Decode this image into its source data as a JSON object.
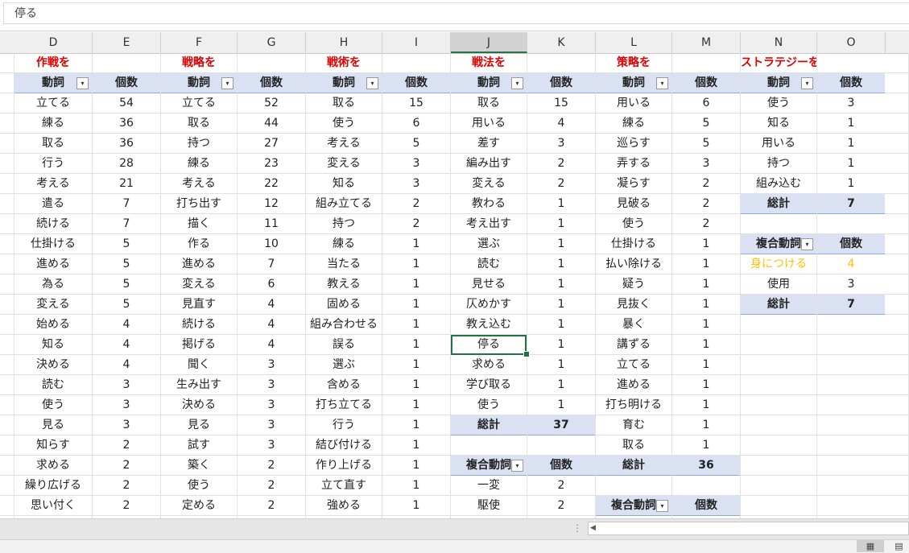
{
  "formula_bar": {
    "value": "停る"
  },
  "columns": [
    "D",
    "E",
    "F",
    "G",
    "H",
    "I",
    "J",
    "K",
    "L",
    "M",
    "N",
    "O"
  ],
  "selected_column": "J",
  "selected_cell": {
    "column": "J",
    "row": 14,
    "value": "停る"
  },
  "colors": {
    "header_fill": "#d9e1f2",
    "title_red": "#e00000",
    "selection_green": "#217346",
    "highlight_yellow": "#ffc000"
  },
  "tables": [
    {
      "title": "作戦を",
      "header": {
        "verb": "動詞",
        "count": "個数"
      },
      "rows": [
        [
          "立てる",
          "54"
        ],
        [
          "練る",
          "36"
        ],
        [
          "取る",
          "36"
        ],
        [
          "行う",
          "28"
        ],
        [
          "考える",
          "21"
        ],
        [
          "遣る",
          "7"
        ],
        [
          "続ける",
          "7"
        ],
        [
          "仕掛ける",
          "5"
        ],
        [
          "進める",
          "5"
        ],
        [
          "為る",
          "5"
        ],
        [
          "変える",
          "5"
        ],
        [
          "始める",
          "4"
        ],
        [
          "知る",
          "4"
        ],
        [
          "決める",
          "4"
        ],
        [
          "読む",
          "3"
        ],
        [
          "使う",
          "3"
        ],
        [
          "見る",
          "3"
        ],
        [
          "知らす",
          "2"
        ],
        [
          "求める",
          "2"
        ],
        [
          "繰り広げる",
          "2"
        ],
        [
          "思い付く",
          "2"
        ]
      ]
    },
    {
      "title": "戦略を",
      "header": {
        "verb": "動詞",
        "count": "個数"
      },
      "rows": [
        [
          "立てる",
          "52"
        ],
        [
          "取る",
          "44"
        ],
        [
          "持つ",
          "27"
        ],
        [
          "練る",
          "23"
        ],
        [
          "考える",
          "22"
        ],
        [
          "打ち出す",
          "12"
        ],
        [
          "描く",
          "11"
        ],
        [
          "作る",
          "10"
        ],
        [
          "進める",
          "7"
        ],
        [
          "変える",
          "6"
        ],
        [
          "見直す",
          "4"
        ],
        [
          "続ける",
          "4"
        ],
        [
          "掲げる",
          "4"
        ],
        [
          "聞く",
          "3"
        ],
        [
          "生み出す",
          "3"
        ],
        [
          "決める",
          "3"
        ],
        [
          "見る",
          "3"
        ],
        [
          "試す",
          "3"
        ],
        [
          "築く",
          "2"
        ],
        [
          "使う",
          "2"
        ],
        [
          "定める",
          "2"
        ]
      ]
    },
    {
      "title": "戦術を",
      "header": {
        "verb": "動詞",
        "count": "個数"
      },
      "rows": [
        [
          "取る",
          "15"
        ],
        [
          "使う",
          "6"
        ],
        [
          "考える",
          "5"
        ],
        [
          "変える",
          "3"
        ],
        [
          "知る",
          "3"
        ],
        [
          "組み立てる",
          "2"
        ],
        [
          "持つ",
          "2"
        ],
        [
          "練る",
          "1"
        ],
        [
          "当たる",
          "1"
        ],
        [
          "教える",
          "1"
        ],
        [
          "固める",
          "1"
        ],
        [
          "組み合わせる",
          "1"
        ],
        [
          "誤る",
          "1"
        ],
        [
          "選ぶ",
          "1"
        ],
        [
          "含める",
          "1"
        ],
        [
          "打ち立てる",
          "1"
        ],
        [
          "行う",
          "1"
        ],
        [
          "結び付ける",
          "1"
        ],
        [
          "作り上げる",
          "1"
        ],
        [
          "立て直す",
          "1"
        ],
        [
          "強める",
          "1"
        ]
      ]
    },
    {
      "title": "戦法を",
      "header": {
        "verb": "動詞",
        "count": "個数"
      },
      "rows": [
        [
          "取る",
          "15"
        ],
        [
          "用いる",
          "4"
        ],
        [
          "差す",
          "3"
        ],
        [
          "編み出す",
          "2"
        ],
        [
          "変える",
          "2"
        ],
        [
          "教わる",
          "1"
        ],
        [
          "考え出す",
          "1"
        ],
        [
          "選ぶ",
          "1"
        ],
        [
          "読む",
          "1"
        ],
        [
          "見せる",
          "1"
        ],
        [
          "仄めかす",
          "1"
        ],
        [
          "教え込む",
          "1"
        ],
        [
          "停る",
          "1"
        ],
        [
          "求める",
          "1"
        ],
        [
          "学び取る",
          "1"
        ],
        [
          "使う",
          "1"
        ]
      ],
      "total": {
        "label": "総計",
        "value": "37"
      },
      "compound": {
        "header": {
          "verb": "複合動詞",
          "count": "個数"
        },
        "rows": [
          [
            "一変",
            "2"
          ],
          [
            "駆使",
            "2"
          ]
        ]
      }
    },
    {
      "title": "策略を",
      "header": {
        "verb": "動詞",
        "count": "個数"
      },
      "rows": [
        [
          "用いる",
          "6"
        ],
        [
          "練る",
          "5"
        ],
        [
          "巡らす",
          "5"
        ],
        [
          "弄する",
          "3"
        ],
        [
          "凝らす",
          "2"
        ],
        [
          "見破る",
          "2"
        ],
        [
          "使う",
          "2"
        ],
        [
          "仕掛ける",
          "1"
        ],
        [
          "払い除ける",
          "1"
        ],
        [
          "疑う",
          "1"
        ],
        [
          "見抜く",
          "1"
        ],
        [
          "暴く",
          "1"
        ],
        [
          "講ずる",
          "1"
        ],
        [
          "立てる",
          "1"
        ],
        [
          "進める",
          "1"
        ],
        [
          "打ち明ける",
          "1"
        ],
        [
          "育む",
          "1"
        ],
        [
          "取る",
          "1"
        ]
      ],
      "total": {
        "label": "総計",
        "value": "36"
      },
      "compound": {
        "header": {
          "verb": "複合動詞",
          "count": "個数"
        },
        "rows": []
      }
    },
    {
      "title": "ストラテジーを",
      "header": {
        "verb": "動詞",
        "count": "個数"
      },
      "rows": [
        [
          "使う",
          "3"
        ],
        [
          "知る",
          "1"
        ],
        [
          "用いる",
          "1"
        ],
        [
          "持つ",
          "1"
        ],
        [
          "組み込む",
          "1"
        ]
      ],
      "total": {
        "label": "総計",
        "value": "7"
      },
      "compound": {
        "header": {
          "verb": "複合動詞",
          "count": "個数"
        },
        "rows": [
          [
            "身につける",
            "4"
          ],
          [
            "使用",
            "3"
          ]
        ],
        "total": {
          "label": "総計",
          "value": "7"
        }
      }
    }
  ],
  "view_buttons": {
    "normal": "▦",
    "page_layout": "▤"
  },
  "scroll_left_arrow": "◀",
  "grip": "⋮"
}
